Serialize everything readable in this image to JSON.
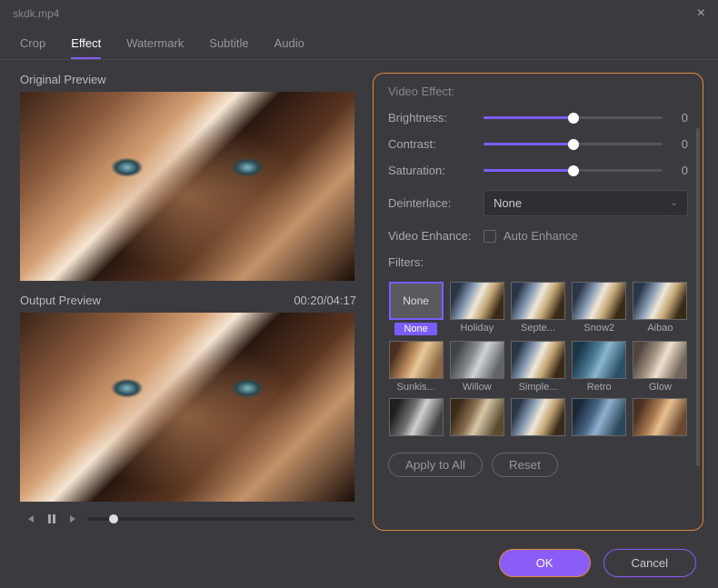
{
  "titlebar": {
    "filename": "skdk.mp4"
  },
  "tabs": {
    "items": [
      {
        "label": "Crop",
        "active": false
      },
      {
        "label": "Effect",
        "active": true
      },
      {
        "label": "Watermark",
        "active": false
      },
      {
        "label": "Subtitle",
        "active": false
      },
      {
        "label": "Audio",
        "active": false
      }
    ]
  },
  "left": {
    "original_label": "Original Preview",
    "output_label": "Output Preview",
    "timecode": "00:20/04:17"
  },
  "effect": {
    "section_label": "Video Effect:",
    "brightness": {
      "label": "Brightness:",
      "value": 0
    },
    "contrast": {
      "label": "Contrast:",
      "value": 0
    },
    "saturation": {
      "label": "Saturation:",
      "value": 0
    },
    "deinterlace": {
      "label": "Deinterlace:",
      "selected": "None"
    },
    "enhance": {
      "label": "Video Enhance:",
      "checkbox_label": "Auto Enhance",
      "checked": false
    },
    "filters_label": "Filters:",
    "filters": [
      {
        "name": "None",
        "selected": true,
        "style": "none"
      },
      {
        "name": "Holiday",
        "style": "default"
      },
      {
        "name": "Septe...",
        "style": "default"
      },
      {
        "name": "Snow2",
        "style": "default"
      },
      {
        "name": "Aibao",
        "style": "default"
      },
      {
        "name": "Sunkis...",
        "style": "sunkissed"
      },
      {
        "name": "Willow",
        "style": "willow"
      },
      {
        "name": "Simple...",
        "style": "default"
      },
      {
        "name": "Retro",
        "style": "retro"
      },
      {
        "name": "Glow",
        "style": "glow"
      }
    ],
    "filters_row3_styles": [
      "bw",
      "sepia",
      "default",
      "cool",
      "warm"
    ],
    "apply_all_label": "Apply to All",
    "reset_label": "Reset"
  },
  "footer": {
    "ok_label": "OK",
    "cancel_label": "Cancel"
  }
}
